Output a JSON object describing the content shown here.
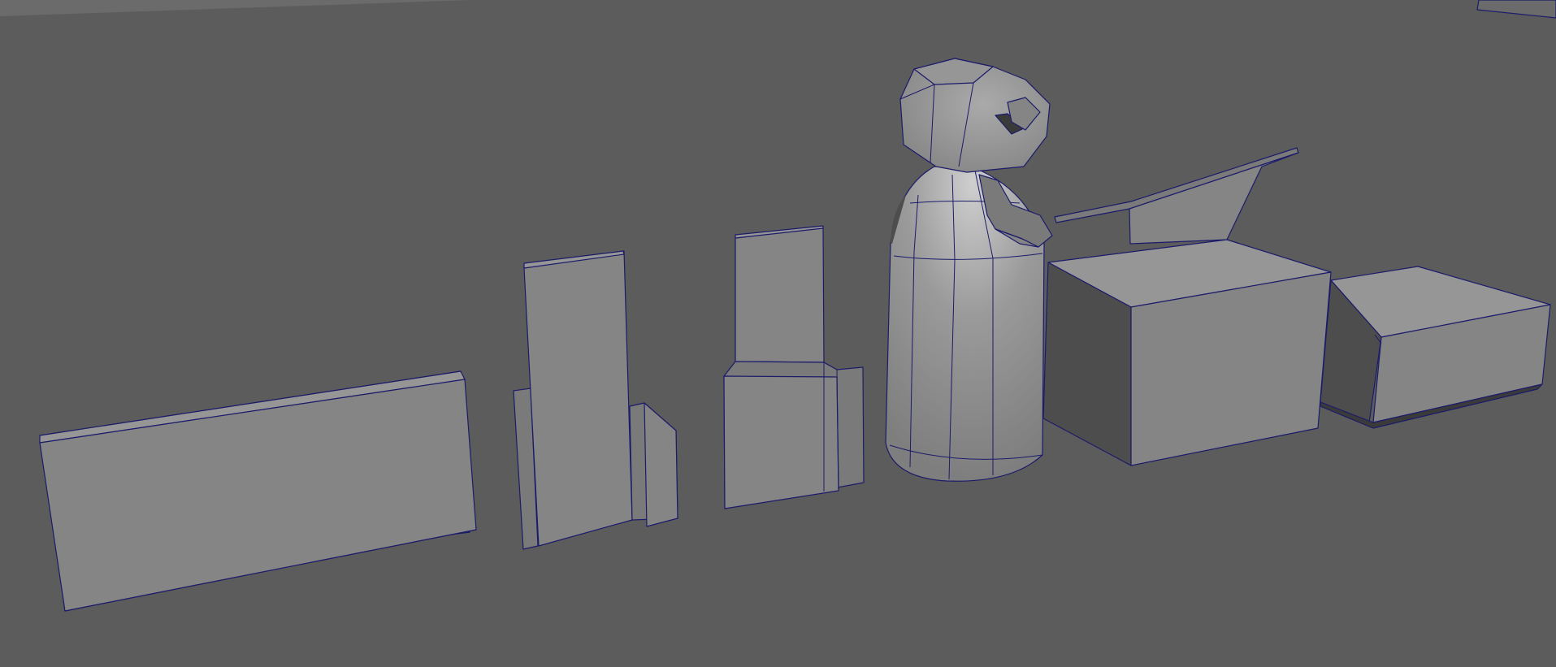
{
  "viewport": {
    "background_color": "#5c5c5c",
    "wireframe_color": "#1b1b6a",
    "shading_colors": {
      "light": "#858585",
      "mid": "#7a7a7a",
      "top": "#969696",
      "dark": "#4d4d4d",
      "darker": "#3a3a3a"
    }
  },
  "scene": {
    "objects": [
      "long-bench",
      "tall-panel",
      "stepped-panel",
      "character-figure",
      "crate-with-lid",
      "flat-box"
    ]
  }
}
